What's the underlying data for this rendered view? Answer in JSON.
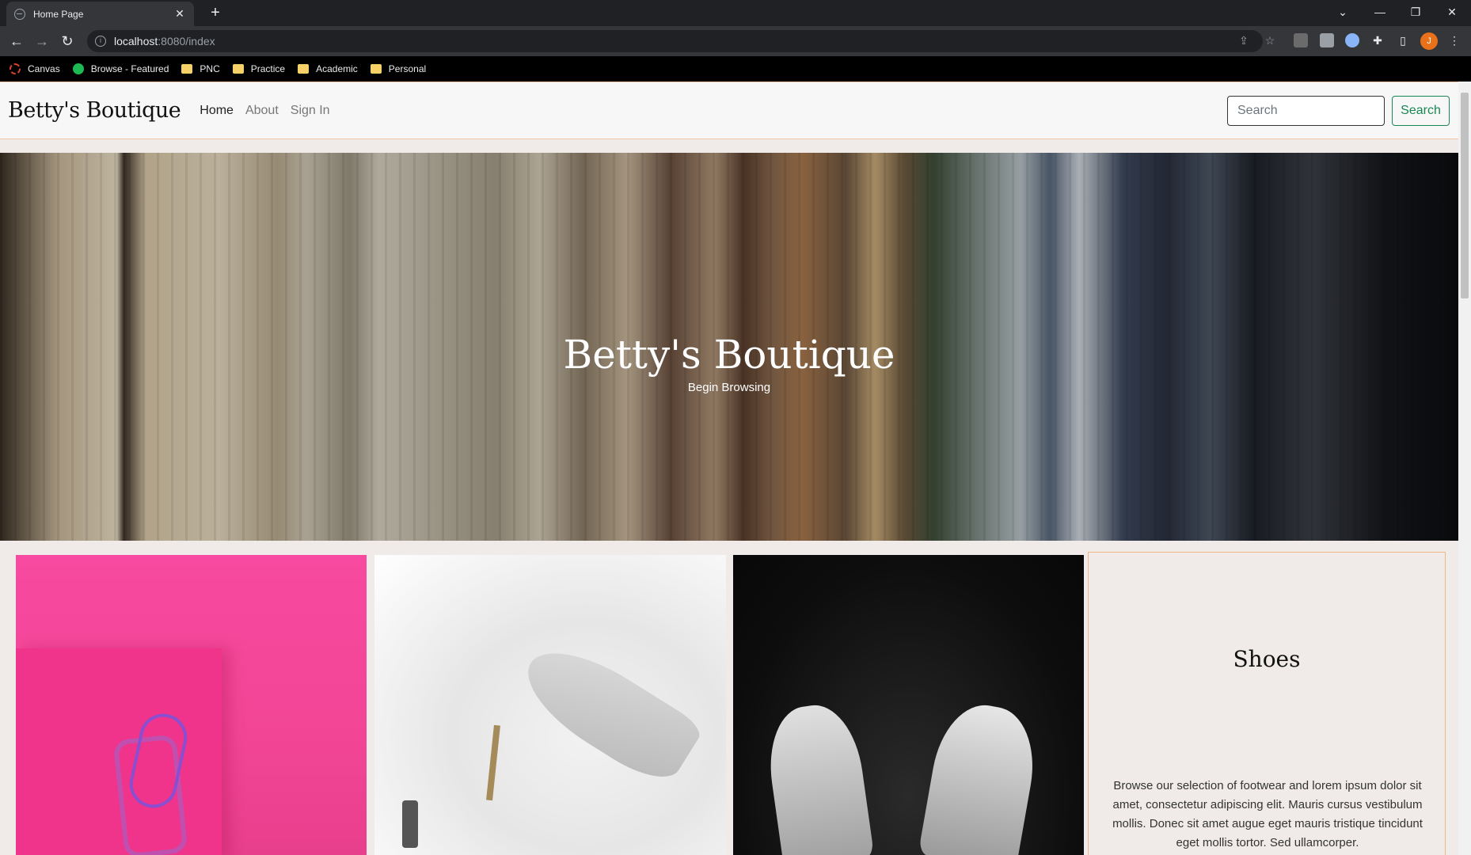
{
  "browser": {
    "tab_title": "Home Page",
    "url_host": "localhost",
    "url_path": ":8080/index",
    "profile_initial": "J"
  },
  "bookmarks": [
    {
      "label": "Canvas",
      "icon": "canvas-icon"
    },
    {
      "label": "Browse - Featured",
      "icon": "spotify-icon"
    },
    {
      "label": "PNC",
      "icon": "folder-icon"
    },
    {
      "label": "Practice",
      "icon": "folder-icon"
    },
    {
      "label": "Academic",
      "icon": "folder-icon"
    },
    {
      "label": "Personal",
      "icon": "folder-icon"
    }
  ],
  "site": {
    "brand": "Betty's Boutique",
    "nav": [
      "Home",
      "About",
      "Sign In"
    ],
    "search_placeholder": "Search",
    "search_button": "Search"
  },
  "hero": {
    "title": "Betty's Boutique",
    "subtitle": "Begin Browsing"
  },
  "feature": {
    "heading": "Shoes",
    "body": "Browse our selection of footwear and lorem ipsum dolor sit amet, consectetur adipiscing elit. Mauris cursus vestibulum mollis. Donec sit amet augue eget mauris tristique tincidunt eget mollis tortor. Sed ullamcorper."
  },
  "colors": {
    "accent_green": "#198754",
    "nav_border": "#f2c4a6",
    "card_border": "#f0b788"
  }
}
